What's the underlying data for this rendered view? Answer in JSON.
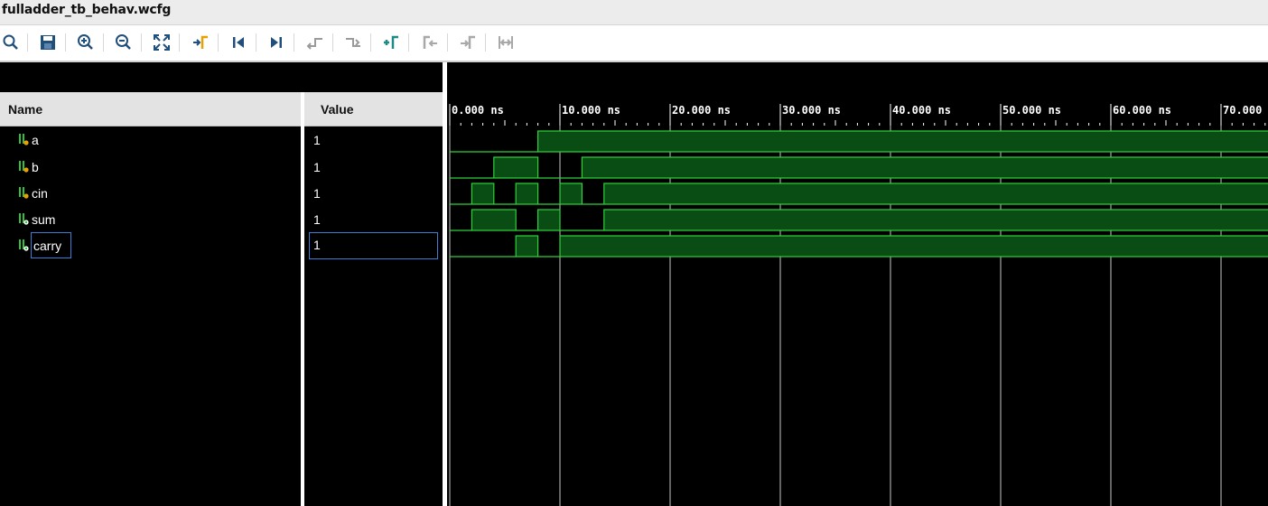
{
  "window": {
    "title": "fulladder_tb_behav.wcfg"
  },
  "toolbar": {
    "buttons": [
      {
        "icon": "search-icon",
        "label": "Search"
      },
      {
        "icon": "save-icon",
        "label": "Save Wave Configuration"
      },
      {
        "icon": "zoom-in-icon",
        "label": "Zoom In"
      },
      {
        "icon": "zoom-out-icon",
        "label": "Zoom Out"
      },
      {
        "icon": "zoom-fit-icon",
        "label": "Zoom Fit"
      },
      {
        "icon": "go-to-cursor-icon",
        "label": "Go To Cursor"
      },
      {
        "icon": "go-to-time-0-icon",
        "label": "Go To Time 0"
      },
      {
        "icon": "go-to-last-time-icon",
        "label": "Go To Last Time"
      },
      {
        "icon": "previous-transition-icon",
        "label": "Previous Transition"
      },
      {
        "icon": "next-transition-icon",
        "label": "Next Transition"
      },
      {
        "icon": "add-marker-icon",
        "label": "Add Marker"
      },
      {
        "icon": "previous-marker-icon",
        "label": "Previous Marker"
      },
      {
        "icon": "next-marker-icon",
        "label": "Next Marker"
      },
      {
        "icon": "swap-cursors-icon",
        "label": "Swap Cursors"
      }
    ]
  },
  "columns": {
    "name": "Name",
    "value": "Value"
  },
  "signals": [
    {
      "name": "a",
      "value": "1",
      "kind": "input",
      "transitions": [
        [
          0,
          0
        ],
        [
          8,
          1
        ]
      ]
    },
    {
      "name": "b",
      "value": "1",
      "kind": "input",
      "transitions": [
        [
          0,
          0
        ],
        [
          4,
          1
        ],
        [
          8,
          0
        ],
        [
          12,
          1
        ]
      ]
    },
    {
      "name": "cin",
      "value": "1",
      "kind": "input",
      "transitions": [
        [
          0,
          0
        ],
        [
          2,
          1
        ],
        [
          4,
          0
        ],
        [
          6,
          1
        ],
        [
          8,
          0
        ],
        [
          10,
          1
        ],
        [
          12,
          0
        ],
        [
          14,
          1
        ]
      ]
    },
    {
      "name": "sum",
      "value": "1",
      "kind": "output",
      "transitions": [
        [
          0,
          0
        ],
        [
          2,
          1
        ],
        [
          6,
          0
        ],
        [
          8,
          1
        ],
        [
          10,
          0
        ],
        [
          14,
          1
        ]
      ]
    },
    {
      "name": "carry",
      "value": "1",
      "kind": "output",
      "selected": true,
      "transitions": [
        [
          0,
          0
        ],
        [
          6,
          1
        ],
        [
          8,
          0
        ],
        [
          10,
          1
        ]
      ]
    }
  ],
  "timeline": {
    "tick_labels": [
      "0.000 ns",
      "10.000 ns",
      "20.000 ns",
      "30.000 ns",
      "40.000 ns",
      "50.000 ns",
      "60.000 ns",
      "70.000"
    ],
    "time_range_ns": [
      0,
      75.5
    ],
    "major_step_ns": 10,
    "minor_step_ns": 1
  },
  "colors": {
    "background": "#000000",
    "wave_fill": "#0a4d14",
    "wave_line": "#2fd03a",
    "grid": "#c8c8c8",
    "selection": "#3a7fd6",
    "input_icon": "#2fc23a",
    "output_icon": "#2fc23a"
  }
}
